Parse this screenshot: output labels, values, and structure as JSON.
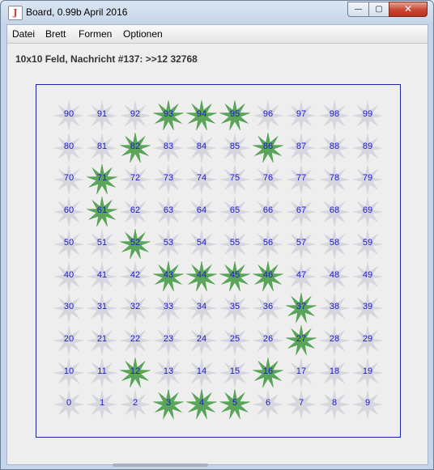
{
  "window": {
    "title": "Board, 0.99b April 2016",
    "controls": {
      "minimize": "—",
      "maximize": "▢",
      "close": "✕"
    }
  },
  "menu": {
    "items": [
      "Datei",
      "Brett",
      "Formen",
      "Optionen"
    ]
  },
  "status_text": "10x10 Feld, Nachricht #137: >>12 32768",
  "board": {
    "rows": 10,
    "cols": 10,
    "colors": {
      "active": "#5aa55a",
      "inactive": "#d6d6de",
      "number": "#1a1acc",
      "border": "#1a2a9a"
    },
    "active_cells": [
      93,
      94,
      95,
      82,
      86,
      71,
      61,
      52,
      43,
      44,
      45,
      46,
      37,
      27,
      12,
      16,
      3,
      4,
      5
    ]
  }
}
